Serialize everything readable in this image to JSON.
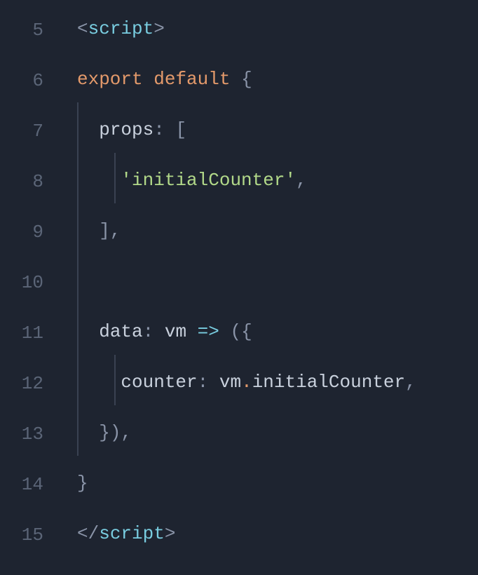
{
  "lines": [
    {
      "num": "5",
      "indent": 0,
      "guides": [],
      "tokens": [
        {
          "c": "tok-punct",
          "t": "<"
        },
        {
          "c": "tok-tag",
          "t": "script"
        },
        {
          "c": "tok-punct",
          "t": ">"
        }
      ]
    },
    {
      "num": "6",
      "indent": 0,
      "guides": [],
      "tokens": [
        {
          "c": "tok-keyword",
          "t": "export"
        },
        {
          "c": "tok-text",
          "t": " "
        },
        {
          "c": "tok-keyword",
          "t": "default"
        },
        {
          "c": "tok-text",
          "t": " "
        },
        {
          "c": "tok-punct",
          "t": "{"
        }
      ]
    },
    {
      "num": "7",
      "indent": 1,
      "guides": [
        1
      ],
      "tokens": [
        {
          "c": "tok-text",
          "t": "props"
        },
        {
          "c": "tok-punct",
          "t": ": ["
        }
      ]
    },
    {
      "num": "8",
      "indent": 2,
      "guides": [
        1,
        2
      ],
      "tokens": [
        {
          "c": "tok-string",
          "t": "'initialCounter'"
        },
        {
          "c": "tok-punct",
          "t": ","
        }
      ]
    },
    {
      "num": "9",
      "indent": 1,
      "guides": [
        1
      ],
      "tokens": [
        {
          "c": "tok-punct",
          "t": "],"
        }
      ]
    },
    {
      "num": "10",
      "indent": 0,
      "guides": [
        1
      ],
      "tokens": []
    },
    {
      "num": "11",
      "indent": 1,
      "guides": [
        1
      ],
      "tokens": [
        {
          "c": "tok-text",
          "t": "data"
        },
        {
          "c": "tok-punct",
          "t": ": "
        },
        {
          "c": "tok-text",
          "t": "vm "
        },
        {
          "c": "tok-arrow",
          "t": "=>"
        },
        {
          "c": "tok-text",
          "t": " "
        },
        {
          "c": "tok-punct",
          "t": "({"
        }
      ]
    },
    {
      "num": "12",
      "indent": 2,
      "guides": [
        1,
        2
      ],
      "tokens": [
        {
          "c": "tok-text",
          "t": "counter"
        },
        {
          "c": "tok-punct",
          "t": ": "
        },
        {
          "c": "tok-text",
          "t": "vm"
        },
        {
          "c": "tok-keyword",
          "t": "."
        },
        {
          "c": "tok-text",
          "t": "initialCounter"
        },
        {
          "c": "tok-punct",
          "t": ","
        }
      ]
    },
    {
      "num": "13",
      "indent": 1,
      "guides": [
        1
      ],
      "tokens": [
        {
          "c": "tok-punct",
          "t": "}),"
        }
      ]
    },
    {
      "num": "14",
      "indent": 0,
      "guides": [],
      "tokens": [
        {
          "c": "tok-punct",
          "t": "}"
        }
      ]
    },
    {
      "num": "15",
      "indent": 0,
      "guides": [],
      "tokens": [
        {
          "c": "tok-punct",
          "t": "</"
        },
        {
          "c": "tok-tag",
          "t": "script"
        },
        {
          "c": "tok-punct",
          "t": ">"
        }
      ]
    }
  ],
  "indentUnit": "  "
}
